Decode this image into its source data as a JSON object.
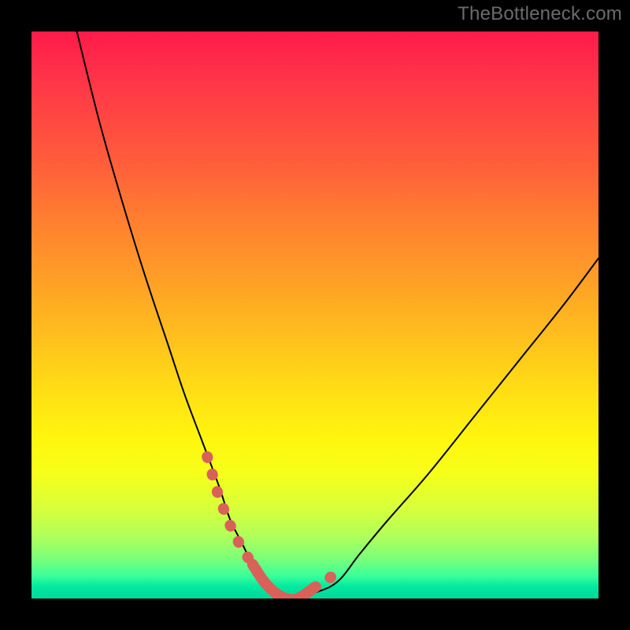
{
  "watermark": "TheBottleneck.com",
  "chart_data": {
    "type": "line",
    "title": "",
    "xlabel": "",
    "ylabel": "",
    "xlim": [
      0,
      100
    ],
    "ylim": [
      0,
      100
    ],
    "series": [
      {
        "name": "bottleneck-curve",
        "x": [
          8,
          12,
          16,
          20,
          24,
          27,
          30,
          33,
          35,
          37,
          39,
          41,
          43,
          45,
          47,
          50,
          54,
          58,
          63,
          70,
          78,
          86,
          94,
          100
        ],
        "y": [
          100,
          84,
          70,
          57,
          45,
          36,
          28,
          20,
          14,
          10,
          6,
          3,
          1,
          0,
          0,
          1,
          3,
          8,
          14,
          22,
          32,
          42,
          52,
          60
        ]
      }
    ],
    "highlight_segments": [
      {
        "name": "left-marker",
        "x": [
          31,
          33,
          35,
          37,
          39
        ],
        "y": [
          25,
          18,
          13,
          9,
          6
        ]
      },
      {
        "name": "right-marker",
        "x": [
          50,
          52,
          54
        ],
        "y": [
          2,
          3,
          5
        ]
      }
    ],
    "colors": {
      "curve": "#000000",
      "highlight": "#d9615a",
      "gradient_top": "#ff1a4b",
      "gradient_bottom": "#00d89a"
    }
  }
}
